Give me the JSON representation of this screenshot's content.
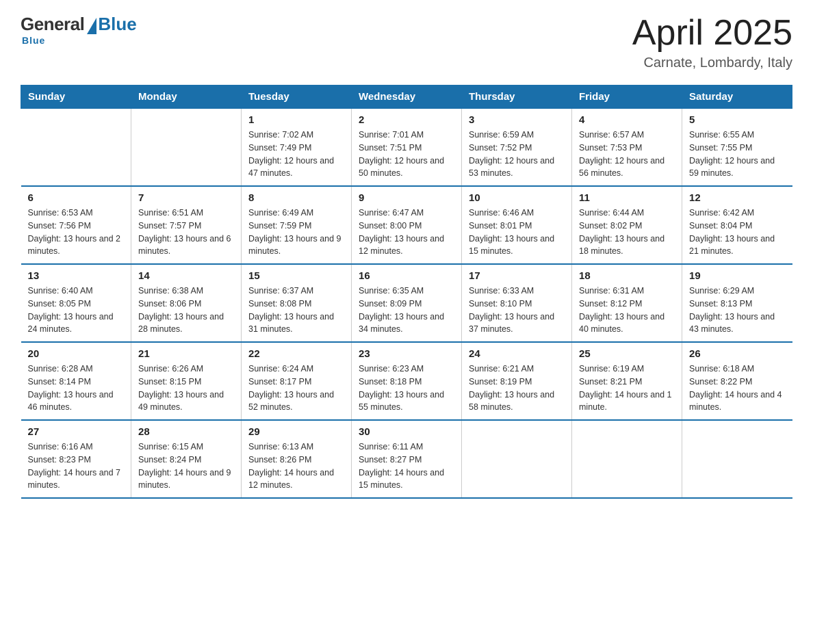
{
  "header": {
    "logo": {
      "general": "General",
      "blue": "Blue",
      "underline": "Blue"
    },
    "title": "April 2025",
    "location": "Carnate, Lombardy, Italy"
  },
  "days_of_week": [
    "Sunday",
    "Monday",
    "Tuesday",
    "Wednesday",
    "Thursday",
    "Friday",
    "Saturday"
  ],
  "weeks": [
    [
      {
        "day": "",
        "info": ""
      },
      {
        "day": "",
        "info": ""
      },
      {
        "day": "1",
        "info": "Sunrise: 7:02 AM\nSunset: 7:49 PM\nDaylight: 12 hours\nand 47 minutes."
      },
      {
        "day": "2",
        "info": "Sunrise: 7:01 AM\nSunset: 7:51 PM\nDaylight: 12 hours\nand 50 minutes."
      },
      {
        "day": "3",
        "info": "Sunrise: 6:59 AM\nSunset: 7:52 PM\nDaylight: 12 hours\nand 53 minutes."
      },
      {
        "day": "4",
        "info": "Sunrise: 6:57 AM\nSunset: 7:53 PM\nDaylight: 12 hours\nand 56 minutes."
      },
      {
        "day": "5",
        "info": "Sunrise: 6:55 AM\nSunset: 7:55 PM\nDaylight: 12 hours\nand 59 minutes."
      }
    ],
    [
      {
        "day": "6",
        "info": "Sunrise: 6:53 AM\nSunset: 7:56 PM\nDaylight: 13 hours\nand 2 minutes."
      },
      {
        "day": "7",
        "info": "Sunrise: 6:51 AM\nSunset: 7:57 PM\nDaylight: 13 hours\nand 6 minutes."
      },
      {
        "day": "8",
        "info": "Sunrise: 6:49 AM\nSunset: 7:59 PM\nDaylight: 13 hours\nand 9 minutes."
      },
      {
        "day": "9",
        "info": "Sunrise: 6:47 AM\nSunset: 8:00 PM\nDaylight: 13 hours\nand 12 minutes."
      },
      {
        "day": "10",
        "info": "Sunrise: 6:46 AM\nSunset: 8:01 PM\nDaylight: 13 hours\nand 15 minutes."
      },
      {
        "day": "11",
        "info": "Sunrise: 6:44 AM\nSunset: 8:02 PM\nDaylight: 13 hours\nand 18 minutes."
      },
      {
        "day": "12",
        "info": "Sunrise: 6:42 AM\nSunset: 8:04 PM\nDaylight: 13 hours\nand 21 minutes."
      }
    ],
    [
      {
        "day": "13",
        "info": "Sunrise: 6:40 AM\nSunset: 8:05 PM\nDaylight: 13 hours\nand 24 minutes."
      },
      {
        "day": "14",
        "info": "Sunrise: 6:38 AM\nSunset: 8:06 PM\nDaylight: 13 hours\nand 28 minutes."
      },
      {
        "day": "15",
        "info": "Sunrise: 6:37 AM\nSunset: 8:08 PM\nDaylight: 13 hours\nand 31 minutes."
      },
      {
        "day": "16",
        "info": "Sunrise: 6:35 AM\nSunset: 8:09 PM\nDaylight: 13 hours\nand 34 minutes."
      },
      {
        "day": "17",
        "info": "Sunrise: 6:33 AM\nSunset: 8:10 PM\nDaylight: 13 hours\nand 37 minutes."
      },
      {
        "day": "18",
        "info": "Sunrise: 6:31 AM\nSunset: 8:12 PM\nDaylight: 13 hours\nand 40 minutes."
      },
      {
        "day": "19",
        "info": "Sunrise: 6:29 AM\nSunset: 8:13 PM\nDaylight: 13 hours\nand 43 minutes."
      }
    ],
    [
      {
        "day": "20",
        "info": "Sunrise: 6:28 AM\nSunset: 8:14 PM\nDaylight: 13 hours\nand 46 minutes."
      },
      {
        "day": "21",
        "info": "Sunrise: 6:26 AM\nSunset: 8:15 PM\nDaylight: 13 hours\nand 49 minutes."
      },
      {
        "day": "22",
        "info": "Sunrise: 6:24 AM\nSunset: 8:17 PM\nDaylight: 13 hours\nand 52 minutes."
      },
      {
        "day": "23",
        "info": "Sunrise: 6:23 AM\nSunset: 8:18 PM\nDaylight: 13 hours\nand 55 minutes."
      },
      {
        "day": "24",
        "info": "Sunrise: 6:21 AM\nSunset: 8:19 PM\nDaylight: 13 hours\nand 58 minutes."
      },
      {
        "day": "25",
        "info": "Sunrise: 6:19 AM\nSunset: 8:21 PM\nDaylight: 14 hours\nand 1 minute."
      },
      {
        "day": "26",
        "info": "Sunrise: 6:18 AM\nSunset: 8:22 PM\nDaylight: 14 hours\nand 4 minutes."
      }
    ],
    [
      {
        "day": "27",
        "info": "Sunrise: 6:16 AM\nSunset: 8:23 PM\nDaylight: 14 hours\nand 7 minutes."
      },
      {
        "day": "28",
        "info": "Sunrise: 6:15 AM\nSunset: 8:24 PM\nDaylight: 14 hours\nand 9 minutes."
      },
      {
        "day": "29",
        "info": "Sunrise: 6:13 AM\nSunset: 8:26 PM\nDaylight: 14 hours\nand 12 minutes."
      },
      {
        "day": "30",
        "info": "Sunrise: 6:11 AM\nSunset: 8:27 PM\nDaylight: 14 hours\nand 15 minutes."
      },
      {
        "day": "",
        "info": ""
      },
      {
        "day": "",
        "info": ""
      },
      {
        "day": "",
        "info": ""
      }
    ]
  ],
  "colors": {
    "header_bg": "#1a6faa",
    "header_text": "#ffffff",
    "border": "#1a6faa",
    "logo_blue": "#1a6faa"
  }
}
